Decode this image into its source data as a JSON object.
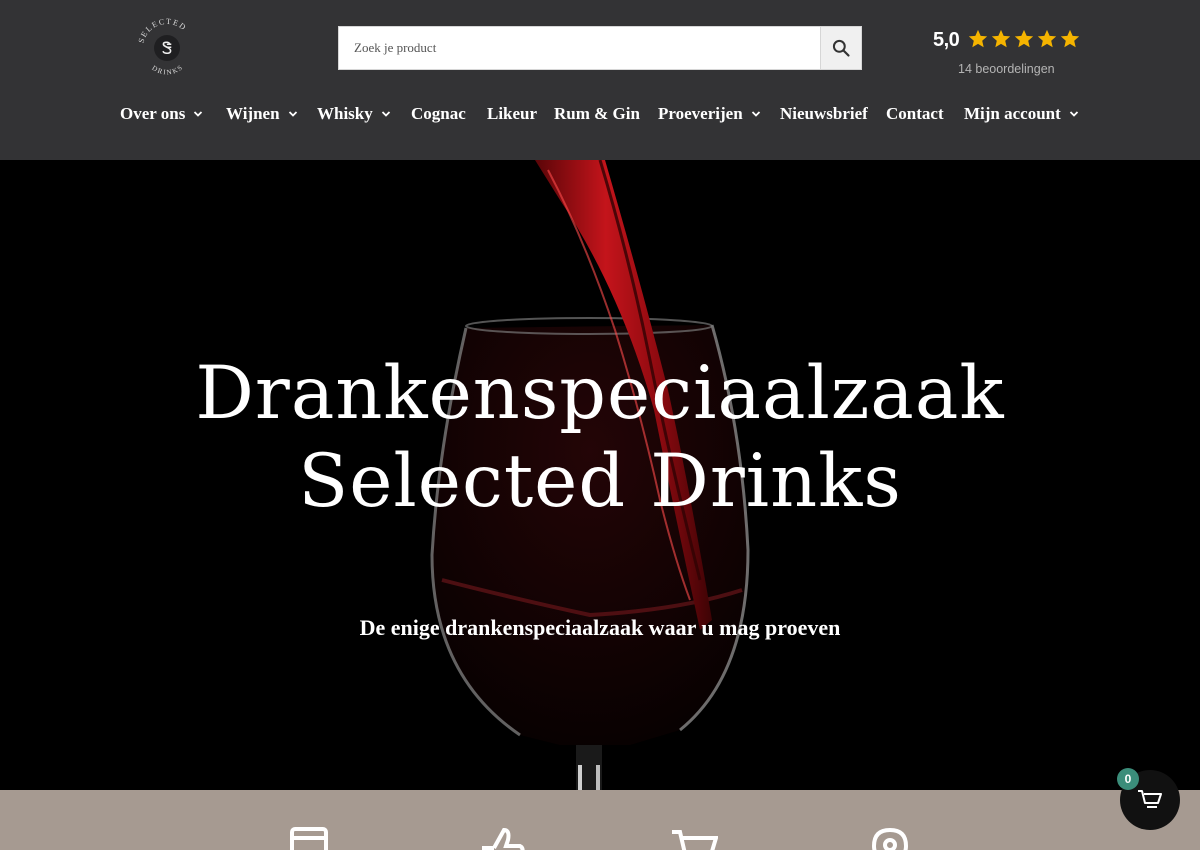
{
  "logo": {
    "brand_top": "SELECTED",
    "brand_bottom": "DRINKS",
    "monogram": "SD"
  },
  "search": {
    "placeholder": "Zoek je product",
    "icon": "search-icon"
  },
  "rating": {
    "score": "5,0",
    "stars": 5,
    "count_label": "14 beoordelingen",
    "star_color": "#f5b400"
  },
  "nav": {
    "items": [
      {
        "label": "Over ons",
        "dropdown": true
      },
      {
        "label": "Wijnen",
        "dropdown": true
      },
      {
        "label": "Whisky",
        "dropdown": true
      },
      {
        "label": "Cognac",
        "dropdown": false
      },
      {
        "label": "Likeur",
        "dropdown": false
      },
      {
        "label": "Rum & Gin",
        "dropdown": false
      },
      {
        "label": "Proeverijen",
        "dropdown": true
      },
      {
        "label": "Nieuwsbrief",
        "dropdown": false
      },
      {
        "label": "Contact",
        "dropdown": false
      },
      {
        "label": "Mijn account",
        "dropdown": true
      }
    ]
  },
  "hero": {
    "title_line1": "Drankenspeciaalzaak",
    "title_line2": "Selected Drinks",
    "subtitle": "De enige drankenspeciaalzaak waar u mag proeven"
  },
  "band": {
    "icons": [
      "document-icon",
      "thumbs-up-icon",
      "cart-icon",
      "location-pin-icon"
    ],
    "color": "#a69a91"
  },
  "cart": {
    "count": "0",
    "icon": "cart-icon",
    "badge_color": "#3b8d7a"
  },
  "colors": {
    "header_bg": "#333335",
    "wine": "#9b0f14"
  }
}
